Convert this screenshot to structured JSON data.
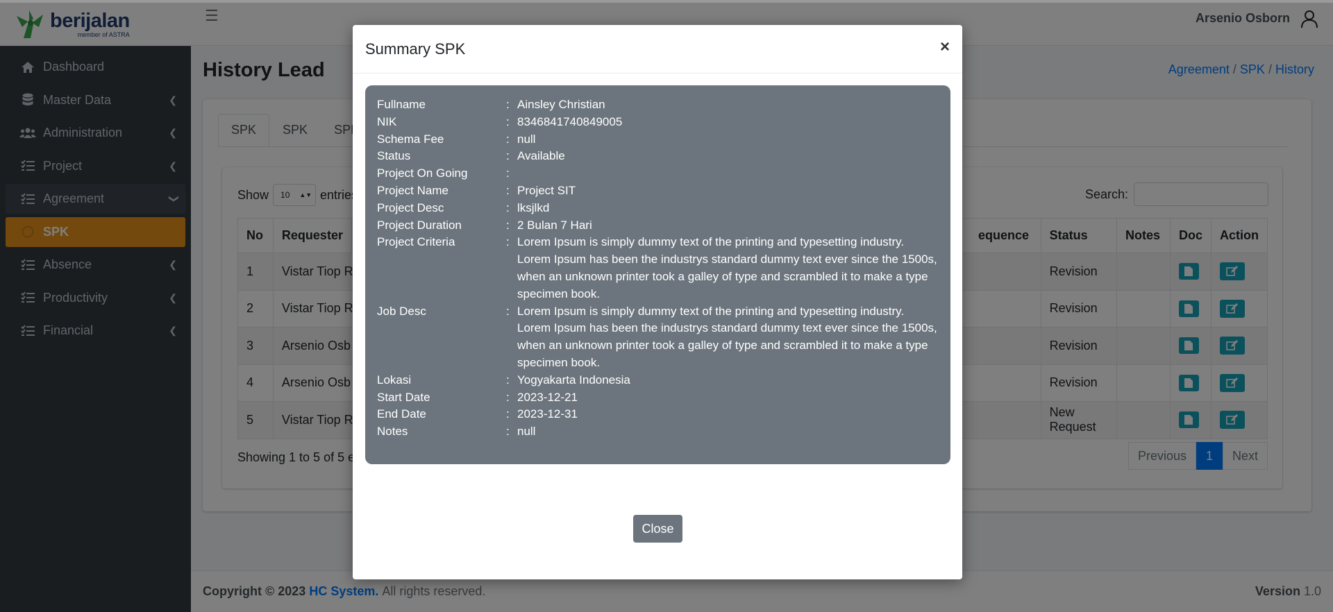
{
  "brand": {
    "name": "berijalan",
    "sub": "member of ASTRA"
  },
  "sidebar": {
    "items": [
      {
        "label": "Dashboard",
        "icon": "home-icon"
      },
      {
        "label": "Master Data",
        "icon": "database-icon"
      },
      {
        "label": "Administration",
        "icon": "users-icon"
      },
      {
        "label": "Project",
        "icon": "tasks-icon"
      },
      {
        "label": "Agreement",
        "icon": "tasks-icon"
      },
      {
        "label": "SPK",
        "icon": "circle-icon"
      },
      {
        "label": "Absence",
        "icon": "tasks-icon"
      },
      {
        "label": "Productivity",
        "icon": "tasks-icon"
      },
      {
        "label": "Financial",
        "icon": "tasks-icon"
      }
    ]
  },
  "header": {
    "user": "Arsenio Osborn"
  },
  "page": {
    "title": "History Lead"
  },
  "breadcrumb": {
    "items": [
      "Agreement",
      "SPK",
      "History"
    ],
    "sep": "/"
  },
  "tabs": [
    "SPK",
    "SPK",
    "SPK"
  ],
  "table_controls": {
    "show": "Show",
    "entries": "entries",
    "entries_value": "10",
    "search_label": "Search:"
  },
  "table": {
    "headers": {
      "no": "No",
      "requester": "Requester",
      "sequence": "equence",
      "status": "Status",
      "notes": "Notes",
      "doc": "Doc",
      "action": "Action"
    },
    "rows": [
      {
        "no": "1",
        "requester": "Vistar Tiop R",
        "status": "Revision"
      },
      {
        "no": "2",
        "requester": "Vistar Tiop R",
        "status": "Revision"
      },
      {
        "no": "3",
        "requester": "Arsenio Osb",
        "status": "Revision"
      },
      {
        "no": "4",
        "requester": "Arsenio Osb",
        "status": "Revision"
      },
      {
        "no": "5",
        "requester": "Vistar Tiop R",
        "status": "New Request"
      }
    ]
  },
  "table_info": "Showing 1 to 5 of 5 e",
  "pagination": {
    "prev": "Previous",
    "current": "1",
    "next": "Next"
  },
  "footer": {
    "copyright": "Copyright © 2023",
    "company": "HC System.",
    "rights": "All rights reserved.",
    "version_label": "Version",
    "version": "1.0"
  },
  "modal": {
    "title": "Summary SPK",
    "close_x": "×",
    "close_button": "Close",
    "fields": [
      {
        "key": "Fullname",
        "value": "Ainsley Christian"
      },
      {
        "key": "NIK",
        "value": "8346841740849005"
      },
      {
        "key": "Schema Fee",
        "value": "null"
      },
      {
        "key": "Status",
        "value": "Available"
      },
      {
        "key": "Project On Going",
        "value": ""
      },
      {
        "key": "Project Name",
        "value": "Project SIT"
      },
      {
        "key": "Project Desc",
        "value": "lksjlkd"
      },
      {
        "key": "Project Duration",
        "value": "2 Bulan 7 Hari"
      },
      {
        "key": "Project Criteria",
        "value": "Lorem Ipsum is simply dummy text of the printing and typesetting industry. Lorem Ipsum has been the industrys standard dummy text ever since the 1500s, when an unknown printer took a galley of type and scrambled it to make a type specimen book."
      },
      {
        "key": "Job Desc",
        "value": "Lorem Ipsum is simply dummy text of the printing and typesetting industry. Lorem Ipsum has been the industrys standard dummy text ever since the 1500s, when an unknown printer took a galley of type and scrambled it to make a type specimen book."
      },
      {
        "key": "Lokasi",
        "value": "Yogyakarta Indonesia"
      },
      {
        "key": "Start Date",
        "value": "2023-12-21"
      },
      {
        "key": "End Date",
        "value": "2023-12-31"
      },
      {
        "key": "Notes",
        "value": "null"
      }
    ],
    "colon": ":"
  },
  "colors": {
    "sidebar": "#343a40",
    "active": "#e8931a",
    "accent": "#007bff",
    "info_btn": "#17a2b8",
    "summary_bg": "#6c757d"
  }
}
